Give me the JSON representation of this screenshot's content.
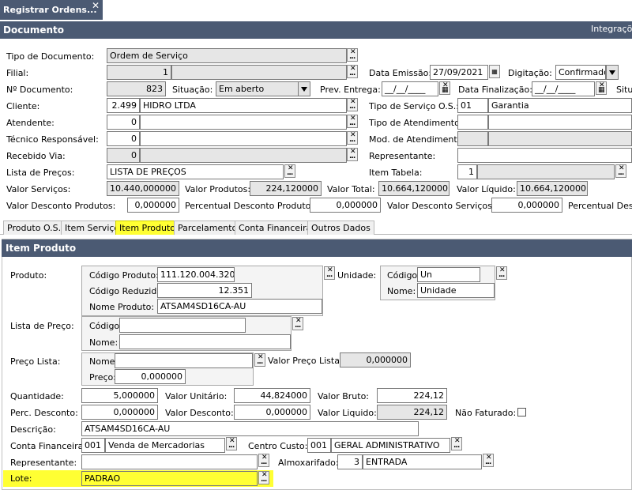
{
  "window": {
    "tab_title": "Registrar Ordens...",
    "close_label": "✕"
  },
  "header": {
    "title": "Documento",
    "right_label": "Integraçõe"
  },
  "doc": {
    "tipo_documento_label": "Tipo de Documento:",
    "tipo_documento": "Ordem de Serviço",
    "filial_label": "Filial:",
    "filial": "1",
    "data_emissao_label": "Data Emissão:",
    "data_emissao": "27/09/2021",
    "digitacao_label": "Digitação:",
    "digitacao": "Confirmado",
    "numero_label": "Nº Documento:",
    "numero": "823",
    "situacao_label": "Situação:",
    "situacao": "Em aberto",
    "prev_entrega_label": "Prev. Entrega:",
    "prev_entrega": "__/__/____",
    "data_finalizacao_label": "Data Finalização:",
    "data_finalizacao": "__/__/____",
    "situ_cut_label": "Situ",
    "cliente_label": "Cliente:",
    "cliente_codigo": "2.499",
    "cliente_nome": "HIDRO LTDA",
    "tipo_servico_label": "Tipo de Serviço O.S.:",
    "tipo_servico_codigo": "01",
    "tipo_servico_nome": "Garantia",
    "atendente_label": "Atendente:",
    "atendente": "0",
    "tipo_atendimento_label": "Tipo de Atendimento:",
    "tecnico_label": "Técnico Responsável:",
    "tecnico": "0",
    "mod_atendimento_label": "Mod. de Atendimento:",
    "recebido_label": "Recebido Via:",
    "recebido": "0",
    "representante_label": "Representante:",
    "lista_precos_label": "Lista de Preços:",
    "lista_precos": "LISTA DE PREÇOS",
    "item_tabela_label": "Item Tabela:",
    "item_tabela": "1",
    "valor_servicos_label": "Valor Serviços:",
    "valor_servicos": "10.440,000000",
    "valor_produtos_label": "Valor Produtos:",
    "valor_produtos": "224,120000",
    "valor_total_label": "Valor Total:",
    "valor_total": "10.664,120000",
    "valor_liquido_label": "Valor Líquido:",
    "valor_liquido": "10.664,120000",
    "desc_produtos_label": "Valor Desconto Produtos:",
    "desc_produtos": "0,000000",
    "perc_desc_produtos_label": "Percentual Desconto Produtos:",
    "perc_desc_produtos": "0,000000",
    "desc_servicos_label": "Valor Desconto Serviços:",
    "desc_servicos": "0,000000",
    "perc_desc_cut_label": "Percentual Desco"
  },
  "tabs": [
    "Produto O.S.",
    "Item Serviço",
    "Item Produto",
    "Parcelamento",
    "Conta Financeira",
    "Outros Dados"
  ],
  "item": {
    "title": "Item Produto",
    "produto_label": "Produto:",
    "codigo_produto_label": "Código Produto:",
    "codigo_produto": "111.120.004.320",
    "codigo_reduzido_label": "Código Reduzido:",
    "codigo_reduzido": "12.351",
    "nome_produto_label": "Nome Produto:",
    "nome_produto": "ATSAM4SD16CA-AU",
    "unidade_label": "Unidade:",
    "un_codigo_label": "Código:",
    "un_codigo": "Un",
    "un_nome_label": "Nome:",
    "un_nome": "Unidade",
    "lista_preco_label": "Lista de Preço:",
    "lp_codigo_label": "Código:",
    "lp_nome_label": "Nome:",
    "preco_lista_label": "Preço Lista:",
    "pl_nome_label": "Nome:",
    "pl_preco_label": "Preço:",
    "pl_preco": "0,000000",
    "valor_preco_lista_label": "Valor Preço Lista:",
    "valor_preco_lista": "0,000000",
    "quantidade_label": "Quantidade:",
    "quantidade": "5,000000",
    "valor_unitario_label": "Valor Unitário:",
    "valor_unitario": "44,824000",
    "valor_bruto_label": "Valor Bruto:",
    "valor_bruto": "224,12",
    "perc_desconto_label": "Perc. Desconto:",
    "perc_desconto": "0,000000",
    "valor_desconto_label": "Valor Desconto:",
    "valor_desconto": "0,000000",
    "valor_liquido_label": "Valor Liquido:",
    "valor_liquido": "224,12",
    "nao_faturado_label": "Não Faturado:",
    "descricao_label": "Descrição:",
    "descricao": "ATSAM4SD16CA-AU",
    "conta_financeira_label": "Conta Financeira:",
    "conta_codigo": "001",
    "conta_nome": "Venda de Mercadorias",
    "centro_custo_label": "Centro Custo:",
    "centro_codigo": "001",
    "centro_nome": "GERAL ADMINISTRATIVO",
    "representante_label": "Representante:",
    "almoxarifado_label": "Almoxarifado:",
    "almox_codigo": "3",
    "almox_nome": "ENTRADA",
    "lote_label": "Lote:",
    "lote": "PADRAO"
  },
  "colors": {
    "header_bg": "#4b5a73",
    "highlight": "#ffff33",
    "readonly_bg": "#e6e6e6"
  }
}
